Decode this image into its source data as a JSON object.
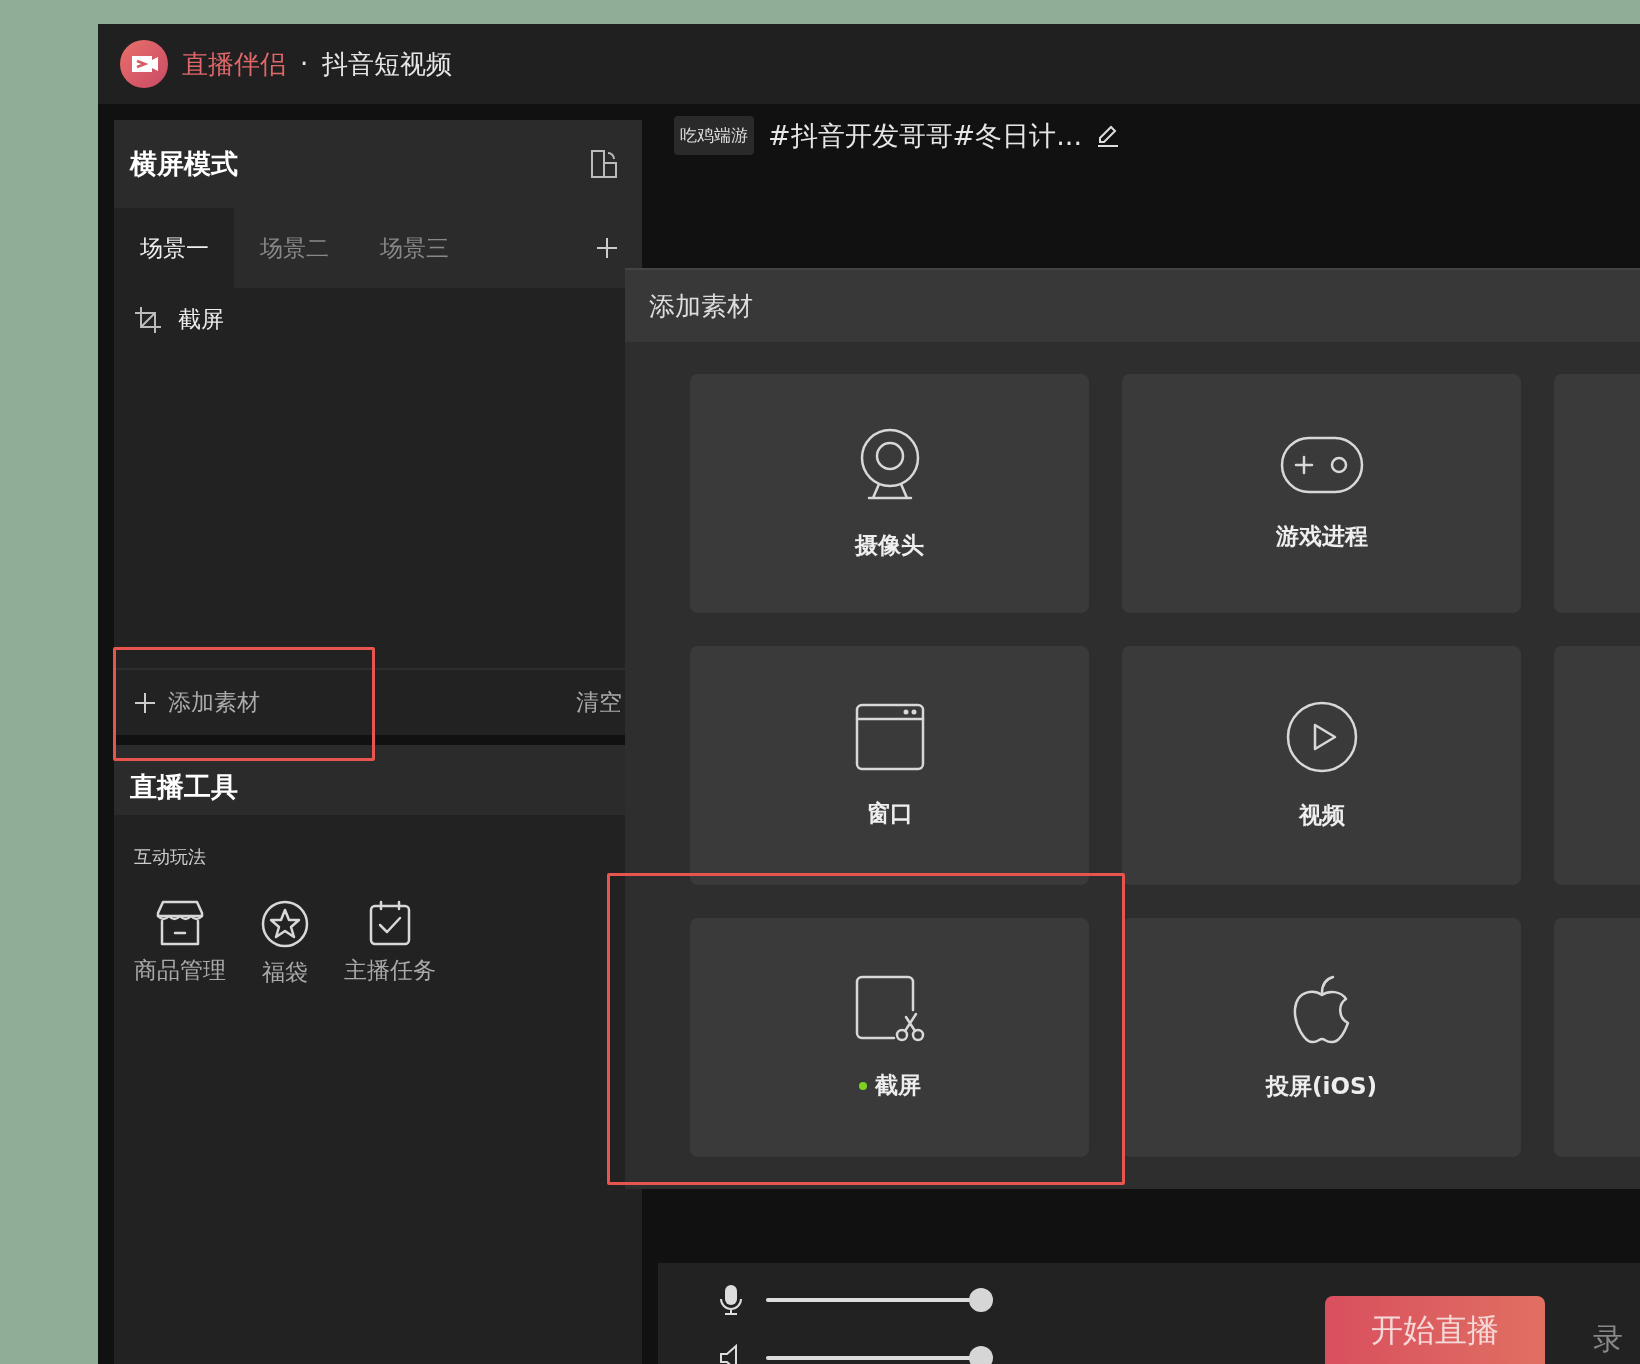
{
  "window": {
    "brand": "直播伴侣",
    "separator": "·",
    "app": "抖音短视频"
  },
  "scene_panel": {
    "mode": "横屏模式",
    "tabs": [
      {
        "label": "场景一",
        "selected": true
      },
      {
        "label": "场景二",
        "selected": false
      },
      {
        "label": "场景三",
        "selected": false
      }
    ],
    "sources": [
      {
        "label": "截屏"
      }
    ],
    "add_button": "添加素材",
    "clear_button": "清空"
  },
  "tools_panel": {
    "title": "直播工具",
    "section": "互动玩法",
    "tools": [
      {
        "label": "商品管理"
      },
      {
        "label": "福袋"
      },
      {
        "label": "主播任务"
      }
    ]
  },
  "stream_info": {
    "category": "吃鸡端游",
    "title": "#抖音开发哥哥#冬日计..."
  },
  "add_material_dialog": {
    "title": "添加素材",
    "items": [
      {
        "label": "摄像头",
        "added": false
      },
      {
        "label": "游戏进程",
        "added": false
      },
      {
        "label": "窗口",
        "added": false
      },
      {
        "label": "视频",
        "added": false
      },
      {
        "label": "截屏",
        "added": true
      },
      {
        "label": "投屏(iOS)",
        "added": false
      }
    ]
  },
  "audio": {
    "channels": [
      {
        "level": 1
      },
      {
        "level": 1
      }
    ]
  },
  "start_button": "开始直播",
  "record_button": "录"
}
